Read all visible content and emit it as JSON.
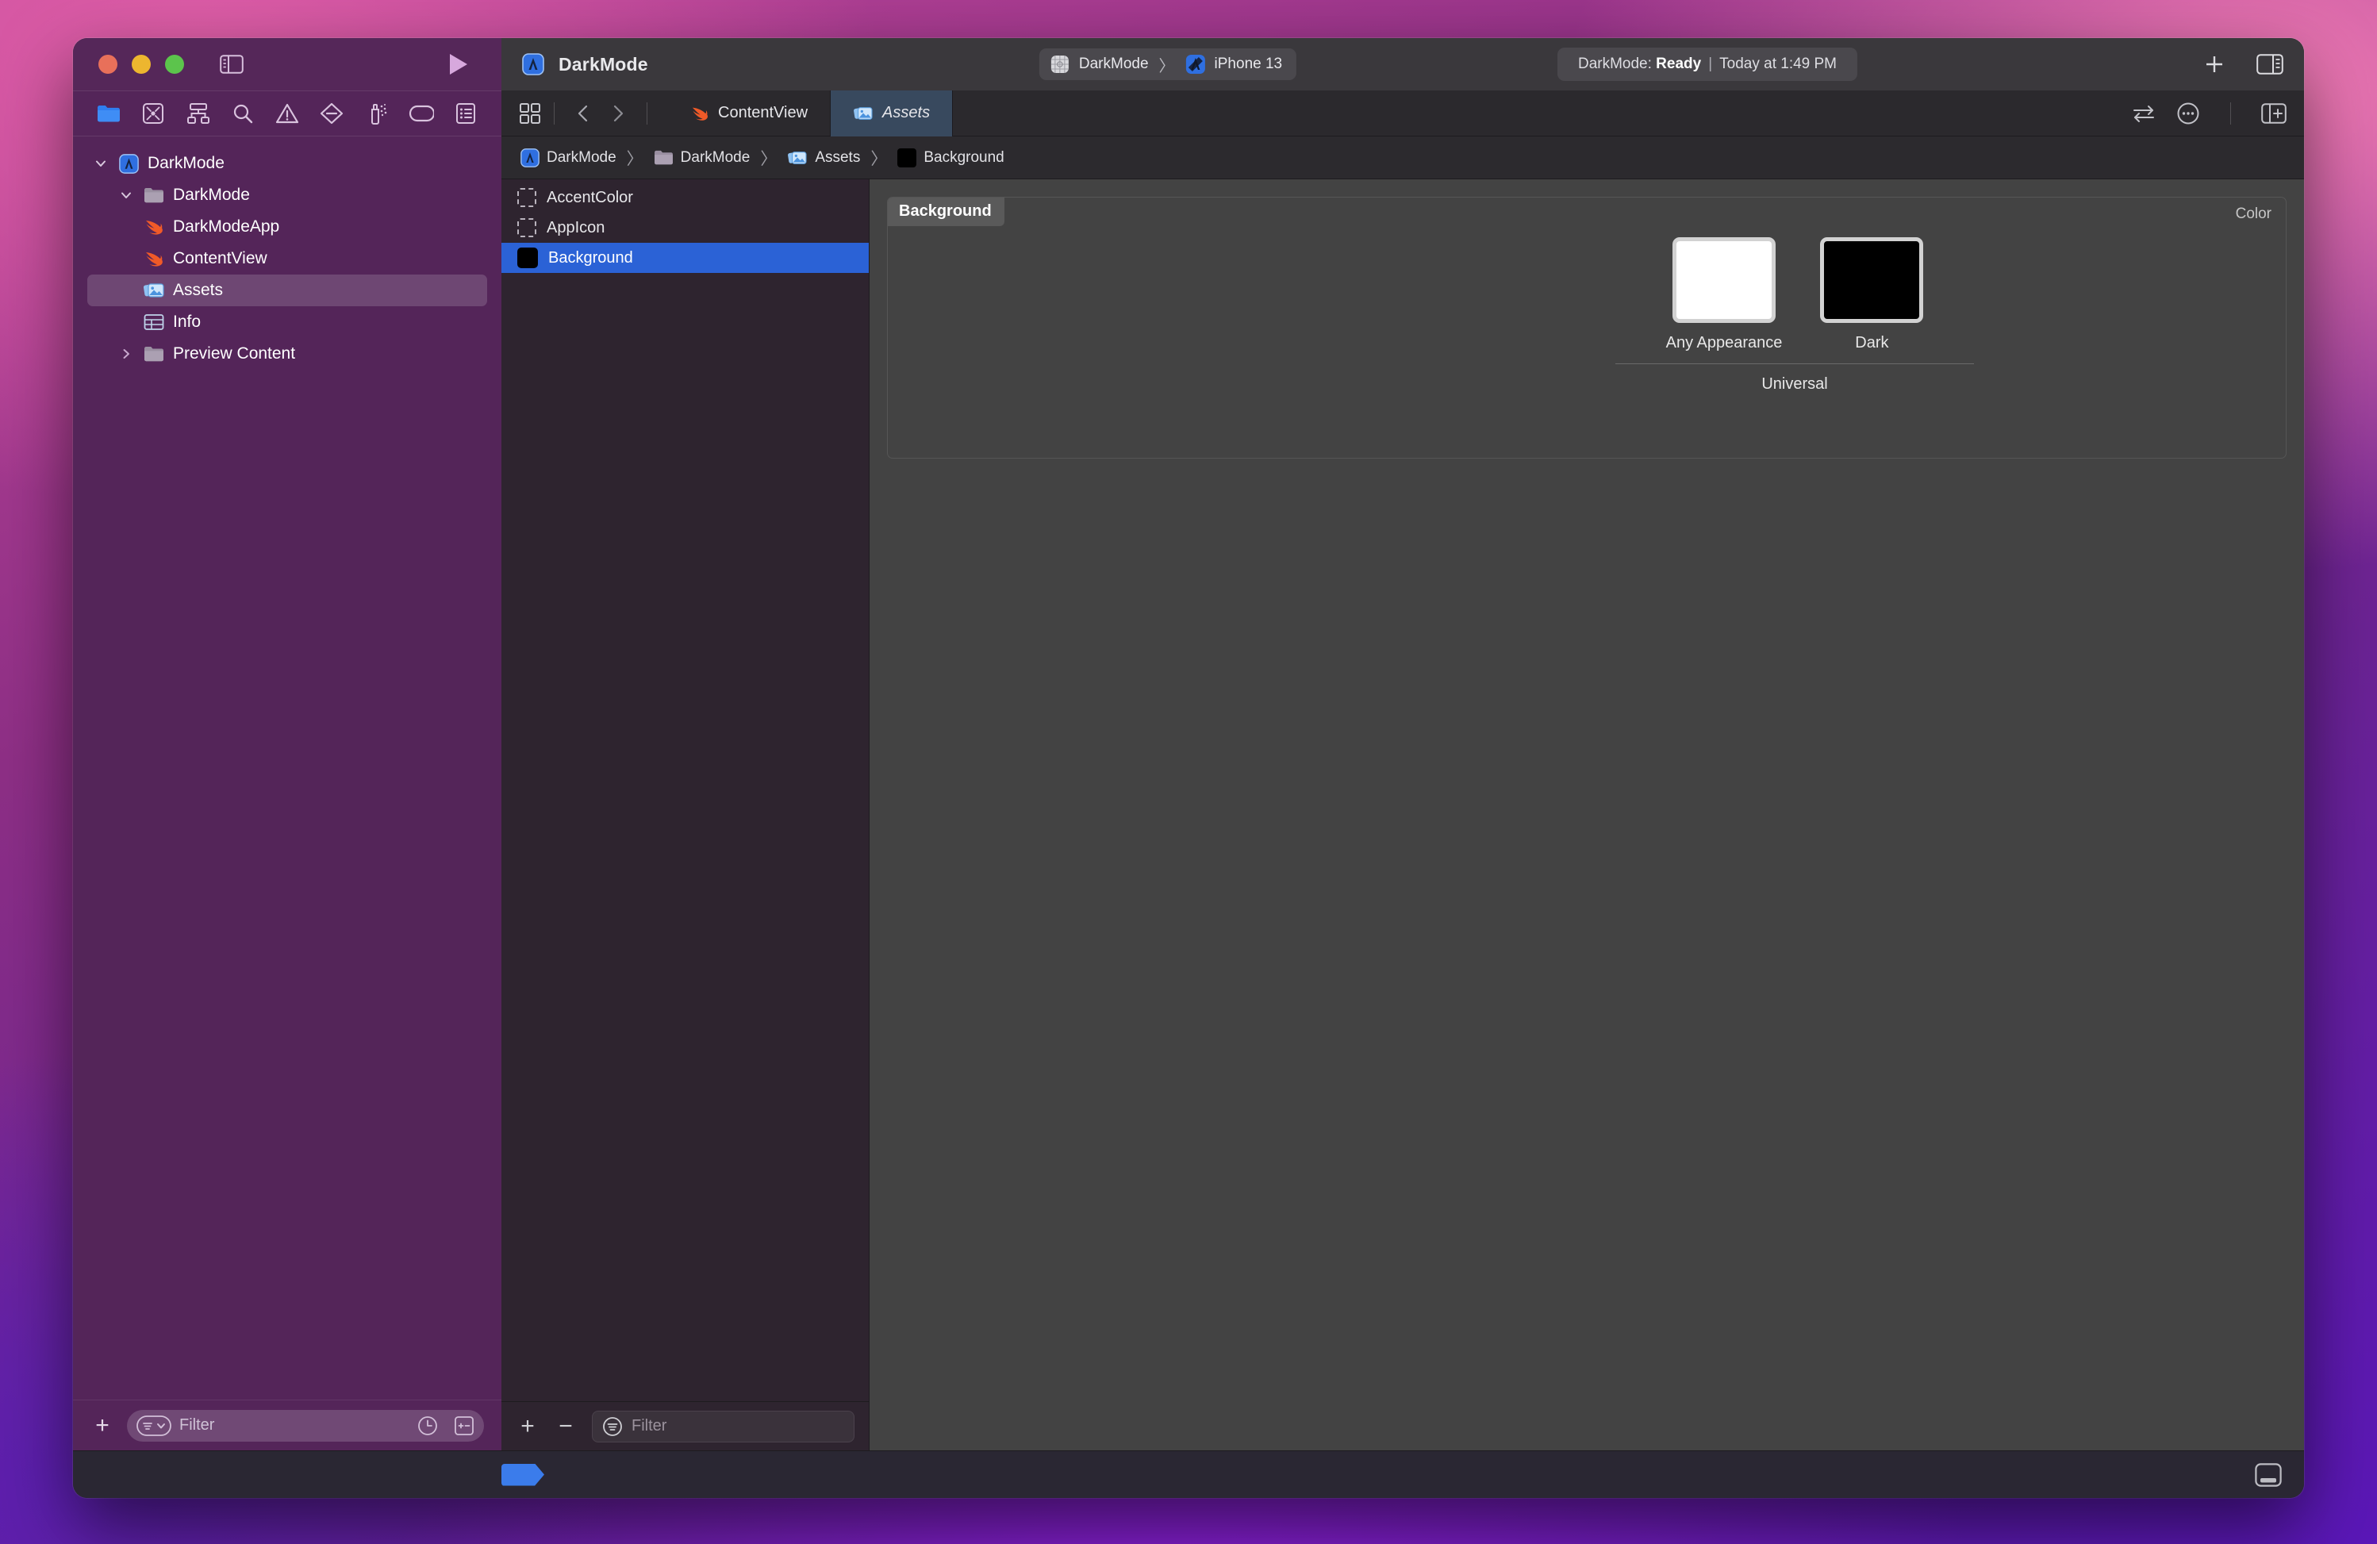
{
  "window": {
    "traffic_lights": [
      "close",
      "minimize",
      "zoom"
    ],
    "app_title": "DarkMode",
    "sidebar_toggle_icon": "sidebar-left-icon",
    "run_button_icon": "play-icon",
    "add_button_icon": "plus-icon",
    "inspector_toggle_icon": "sidebar-right-icon"
  },
  "scheme": {
    "project_icon": "xcode-project-icon",
    "project": "DarkMode",
    "separator": "〉",
    "device_icon": "simulator-icon",
    "device": "iPhone 13"
  },
  "status": {
    "prefix": "DarkMode:",
    "state": "Ready",
    "divider": "|",
    "time": "Today at 1:49 PM"
  },
  "navigator": {
    "toolbar_icons": [
      {
        "name": "folder-icon",
        "label": "Project navigator",
        "active": true
      },
      {
        "name": "source-control-icon",
        "label": "Source control navigator",
        "active": false
      },
      {
        "name": "hierarchy-icon",
        "label": "Symbol navigator",
        "active": false
      },
      {
        "name": "search-icon",
        "label": "Find navigator",
        "active": false
      },
      {
        "name": "warning-triangle-icon",
        "label": "Issue navigator",
        "active": false
      },
      {
        "name": "breakpoint-diamond-icon",
        "label": "Breakpoint navigator",
        "active": false
      },
      {
        "name": "test-spray-icon",
        "label": "Test navigator",
        "active": false
      },
      {
        "name": "tag-icon",
        "label": "Debug navigator",
        "active": false
      },
      {
        "name": "report-list-icon",
        "label": "Report navigator",
        "active": false
      }
    ],
    "tree": [
      {
        "label": "DarkMode",
        "indent": 0,
        "disclosure": "open",
        "icon": "xcode-project-icon",
        "selected": false
      },
      {
        "label": "DarkMode",
        "indent": 1,
        "disclosure": "open",
        "icon": "folder-grey-icon",
        "selected": false
      },
      {
        "label": "DarkModeApp",
        "indent": 2,
        "disclosure": "none",
        "icon": "swift-icon",
        "selected": false
      },
      {
        "label": "ContentView",
        "indent": 2,
        "disclosure": "none",
        "icon": "swift-icon",
        "selected": false
      },
      {
        "label": "Assets",
        "indent": 2,
        "disclosure": "none",
        "icon": "assets-icon",
        "selected": true
      },
      {
        "label": "Info",
        "indent": 2,
        "disclosure": "none",
        "icon": "plist-table-icon",
        "selected": false
      },
      {
        "label": "Preview Content",
        "indent": 1,
        "disclosure": "closed",
        "icon": "folder-grey-icon",
        "selected": false
      }
    ],
    "filter": {
      "add_label": "+",
      "icon": "filter-pill-icon",
      "placeholder": "Filter",
      "value": "",
      "trailing_icons": [
        "clock-icon",
        "source-control-changes-icon"
      ]
    }
  },
  "editor": {
    "tabbar": {
      "grid_icon": "tab-grid-icon",
      "back_icon": "chevron-left-icon",
      "forward_icon": "chevron-right-icon",
      "tabs": [
        {
          "label": "ContentView",
          "icon": "swift-icon",
          "active": false
        },
        {
          "label": "Assets",
          "icon": "assets-icon",
          "active": true
        }
      ],
      "trailing_icons": [
        "swap-arrows-icon",
        "ellipsis-circle-icon",
        "add-editor-icon"
      ]
    },
    "breadcrumb": [
      {
        "label": "DarkMode",
        "icon": "xcode-project-icon"
      },
      {
        "label": "DarkMode",
        "icon": "folder-grey-icon"
      },
      {
        "label": "Assets",
        "icon": "assets-icon"
      },
      {
        "label": "Background",
        "icon": "black-swatch-icon"
      }
    ],
    "breadcrumb_separator": "〉"
  },
  "asset_list": {
    "items": [
      {
        "label": "AccentColor",
        "icon": "dashed-placeholder-icon",
        "color": "",
        "selected": false
      },
      {
        "label": "AppIcon",
        "icon": "dashed-placeholder-icon",
        "color": "",
        "selected": false
      },
      {
        "label": "Background",
        "icon": "color-swatch-icon",
        "color": "#000000",
        "selected": true
      }
    ],
    "footer": {
      "add_label": "+",
      "remove_label": "−",
      "filter_icon": "filter-icon",
      "filter_placeholder": "Filter",
      "filter_value": ""
    }
  },
  "asset_detail": {
    "title": "Background",
    "kind": "Color",
    "appearances": [
      {
        "label": "Any Appearance",
        "color": "#FFFFFF"
      },
      {
        "label": "Dark",
        "color": "#000000"
      }
    ],
    "group_label": "Universal"
  },
  "statusbar": {
    "tag_icon": "blue-tag-icon",
    "bottom_panel_icon": "bottom-panel-toggle-icon"
  },
  "colors": {
    "navigator_bg": "#542559",
    "titlebar_left_bg": "#552759",
    "titlebar_right_bg": "#3A383C",
    "asset_list_bg": "#2E242F",
    "editor_bg": "#434343",
    "selection_blue": "#2B62D6",
    "tab_active_bg": "#38495E",
    "accent_blue": "#3B7CEB"
  }
}
